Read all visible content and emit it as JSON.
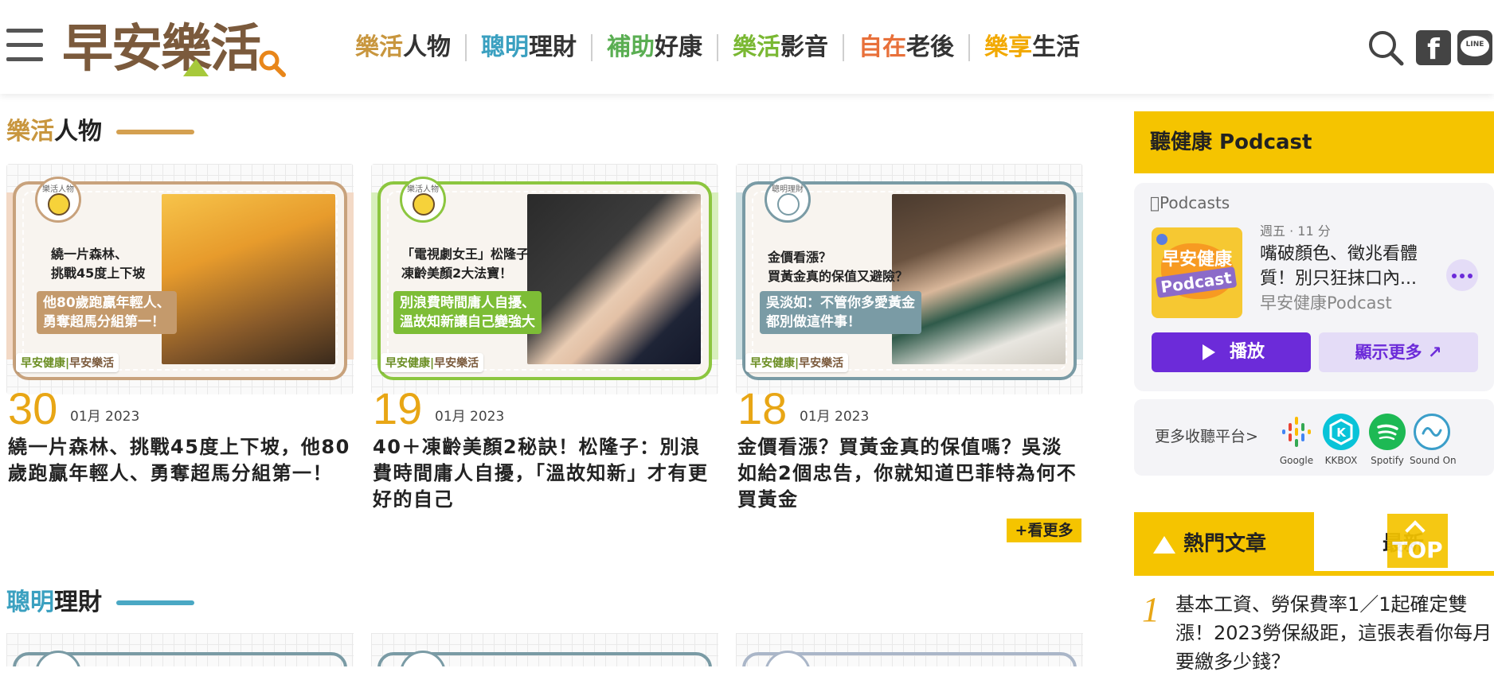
{
  "header": {
    "logo_text": "早安樂活",
    "nav": [
      {
        "accent": "樂活",
        "rest": "人物",
        "accent_color": "#c8963e"
      },
      {
        "accent": "聰明",
        "rest": "理財",
        "accent_color": "#3aa0c0"
      },
      {
        "accent": "補助",
        "rest": "好康",
        "accent_color": "#5aae52"
      },
      {
        "accent": "樂活",
        "rest": "影音",
        "accent_color": "#7ab833"
      },
      {
        "accent": "自在",
        "rest": "老後",
        "accent_color": "#e8703a"
      },
      {
        "accent": "樂享",
        "rest": "生活",
        "accent_color": "#f2a900"
      }
    ],
    "icons": [
      "menu-icon",
      "search-icon",
      "facebook-icon",
      "line-icon"
    ],
    "fb_glyph": "f",
    "line_glyph": "LINE"
  },
  "sections": [
    {
      "accent": "樂活",
      "rest": "人物",
      "accent_color": "#c8963e",
      "bar_color": "#d4a050"
    },
    {
      "accent": "聰明",
      "rest": "理財",
      "accent_color": "#3aa0c0",
      "bar_color": "#4aa8c4"
    }
  ],
  "cards": [
    {
      "badge": "樂活人物",
      "frame_color": "#c8a27c",
      "band_color": "#f3d9c6",
      "headline": "繞一片森林、\n挑戰45度上下坡",
      "subhead": "他80歲跑贏年輕人、\n勇奪超馬分組第一！",
      "sub_color": "#c49a6c",
      "day": "30",
      "month_year": "01月 2023",
      "title": "繞一片森林、挑戰45度上下坡，他80歲跑贏年輕人、勇奪超馬分組第一！"
    },
    {
      "badge": "樂活人物",
      "frame_color": "#8cc63f",
      "band_color": "#d8efbc",
      "headline": "「電視劇女王」松隆子\n凍齡美顏2大法寶！",
      "subhead": "別浪費時間庸人自擾、\n溫故知新讓自己變強大",
      "sub_color": "#7dbd36",
      "day": "19",
      "month_year": "01月 2023",
      "title": "40＋凍齡美顏2秘訣！松隆子：別浪費時間庸人自擾，「溫故知新」才有更好的自己"
    },
    {
      "badge": "聰明理財",
      "frame_color": "#7a9ba5",
      "band_color": "#cfe0e3",
      "headline": "金價看漲？\n買黃金真的保值又避險？",
      "subhead": "吳淡如：不管你多愛黃金\n都別做這件事！",
      "sub_color": "#7a9ba5",
      "day": "18",
      "month_year": "01月 2023",
      "title": "金價看漲？買黃金真的保值嗎？吳淡如給2個忠告，你就知道巴菲特為何不買黃金"
    }
  ],
  "brand_stamp": {
    "a": "早安健康",
    "b": "早安樂活"
  },
  "more_label": "+看更多",
  "podcast": {
    "heading": "聽健康 Podcast",
    "apple_label": "Podcasts",
    "art_line1": "早安健康",
    "art_line2": "Podcast",
    "meta": "週五 · 11 分",
    "episode": "嘴破顏色、徵兆看體質！別只狂抹口內...",
    "show": "早安健康Podcast",
    "play_label": "播放",
    "show_more_label": "顯示更多 ↗"
  },
  "platforms": {
    "label": "更多收聽平台>",
    "items": [
      {
        "name": "Google",
        "icon": "google-podcasts-icon"
      },
      {
        "name": "KKBOX",
        "icon": "kkbox-icon"
      },
      {
        "name": "Spotify",
        "icon": "spotify-icon"
      },
      {
        "name": "Sound On",
        "icon": "soundon-icon"
      }
    ]
  },
  "hot": {
    "tab_active": "熱門文章",
    "tab_other": "最新",
    "top_label": "TOP",
    "rank_number": "1",
    "rank_text": "基本工資、勞保費率1／1起確定雙漲！2023勞保級距，這張表看你每月要繳多少錢？"
  }
}
